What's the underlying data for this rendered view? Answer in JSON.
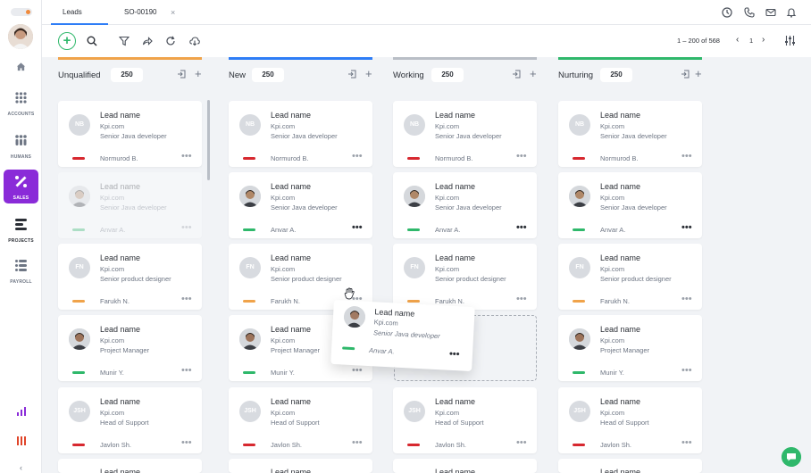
{
  "sidebar": {
    "items": [
      {
        "label": "ACCOUNTS"
      },
      {
        "label": "HUMANS"
      },
      {
        "label": "SALES"
      },
      {
        "label": "PROJECTS"
      },
      {
        "label": "PAYROLL"
      }
    ]
  },
  "tabs": [
    {
      "label": "Leads"
    },
    {
      "label": "SO-00190"
    }
  ],
  "tab_close": "×",
  "pager": {
    "range": "1 – 200 of 568",
    "page": "1",
    "prev": "‹",
    "next": "›"
  },
  "add_symbol": "+",
  "columns": [
    {
      "title": "Unqualified",
      "count": "250",
      "color": "#f0a34a"
    },
    {
      "title": "New",
      "count": "250",
      "color": "#2e7df6"
    },
    {
      "title": "Working",
      "count": "250",
      "color": "#b9bec6"
    },
    {
      "title": "Nurturing",
      "count": "250",
      "color": "#2fb86b"
    }
  ],
  "cards": {
    "row1": {
      "name": "Lead name",
      "company": "Kpi.com",
      "role": "Senior Java developer",
      "owner": "Normurod B.",
      "initials": "NB",
      "status_color": "#d7282f"
    },
    "row2": {
      "name": "Lead name",
      "company": "Kpi.com",
      "role": "Senior Java developer",
      "owner": "Anvar A.",
      "status_color": "#2fb86b"
    },
    "row3": {
      "name": "Lead name",
      "company": "Kpi.com",
      "role": "Senior product designer",
      "owner": "Farukh N.",
      "initials": "FN",
      "status_color": "#f0a34a"
    },
    "row4": {
      "name": "Lead name",
      "company": "Kpi.com",
      "role": "Project Manager",
      "owner": "Munir Y.",
      "status_color": "#2fb86b"
    },
    "row5": {
      "name": "Lead name",
      "company": "Kpi.com",
      "role": "Head of Support",
      "owner": "Javlon Sh.",
      "initials": "JSH",
      "status_color": "#d7282f"
    },
    "row6": {
      "name": "Lead name"
    }
  },
  "drag_card": {
    "name": "Lead name",
    "company": "Kpi.com",
    "role": "Senior Java developer",
    "owner": "Anvar A."
  },
  "more": "•••"
}
